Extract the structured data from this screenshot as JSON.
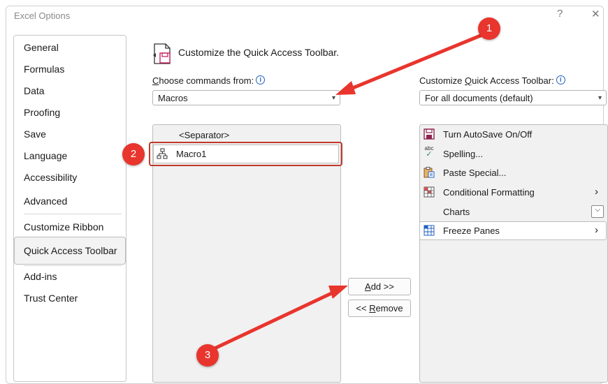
{
  "window": {
    "title": "Excel Options",
    "help_glyph": "?",
    "close_glyph": "✕"
  },
  "sidebar": {
    "items": [
      {
        "label": "General"
      },
      {
        "label": "Formulas"
      },
      {
        "label": "Data"
      },
      {
        "label": "Proofing"
      },
      {
        "label": "Save"
      },
      {
        "label": "Language"
      },
      {
        "label": "Accessibility"
      },
      {
        "label": "Advanced"
      },
      {
        "label": "Customize Ribbon"
      },
      {
        "label": "Quick Access Toolbar",
        "selected": true
      },
      {
        "label": "Add-ins"
      },
      {
        "label": "Trust Center"
      }
    ]
  },
  "main": {
    "header": "Customize the Quick Access Toolbar.",
    "choose": {
      "label_key": "C",
      "label_rest": "hoose commands from:",
      "value": "Macros"
    },
    "customize": {
      "label_pre": "Customize ",
      "label_key": "Q",
      "label_rest": "uick Access Toolbar:",
      "value": "For all documents (default)"
    },
    "commands": [
      {
        "label": "<Separator>"
      },
      {
        "label": "Macro1",
        "icon": "macro-icon",
        "selected": true
      }
    ],
    "toolbar_items": [
      {
        "label": "Turn AutoSave On/Off",
        "icon": "autosave-icon"
      },
      {
        "label": "Spelling...",
        "icon": "spelling-icon",
        "icon_text": "abc"
      },
      {
        "label": "Paste Special...",
        "icon": "paste-special-icon"
      },
      {
        "label": "Conditional Formatting",
        "icon": "conditional-formatting-icon",
        "submenu": "›"
      },
      {
        "label": "Charts",
        "dropdown": "⌵"
      },
      {
        "label": "Freeze Panes",
        "icon": "freeze-panes-icon",
        "submenu": "›",
        "selected": true
      }
    ],
    "buttons": {
      "add_key": "A",
      "add_rest": "dd >>",
      "remove_pre": "<< ",
      "remove_key": "R",
      "remove_rest": "emove"
    }
  },
  "annotations": [
    {
      "number": "1"
    },
    {
      "number": "2"
    },
    {
      "number": "3"
    }
  ],
  "colors": {
    "accent": "#e8352d",
    "info": "#1f5fbf",
    "selection_border": "#c0392b"
  }
}
